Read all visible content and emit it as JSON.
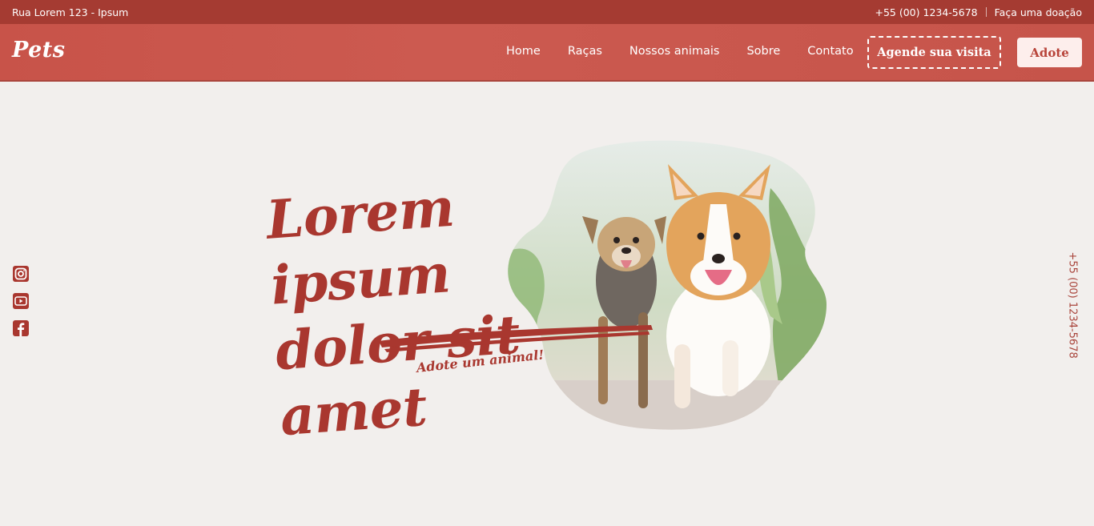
{
  "topbar": {
    "address": "Rua Lorem 123 - Ipsum",
    "phone": "+55 (00) 1234-5678",
    "donate": "Faça uma doação"
  },
  "header": {
    "logo": "Pets",
    "nav": [
      "Home",
      "Raças",
      "Nossos animais",
      "Sobre",
      "Contato"
    ],
    "visit_button": "Agende sua visita",
    "adopt_button": "Adote"
  },
  "hero": {
    "title_line1": "Lorem ipsum",
    "title_line2": "dolor sit amet",
    "cta": "Adote um animal!"
  },
  "social": [
    "instagram-icon",
    "youtube-icon",
    "facebook-icon"
  ],
  "side_phone": "+55 (00) 1234-5678",
  "colors": {
    "primary": "#a9372f",
    "topbar": "#a53b32",
    "navbar": "#c85349",
    "background": "#f2efed"
  }
}
